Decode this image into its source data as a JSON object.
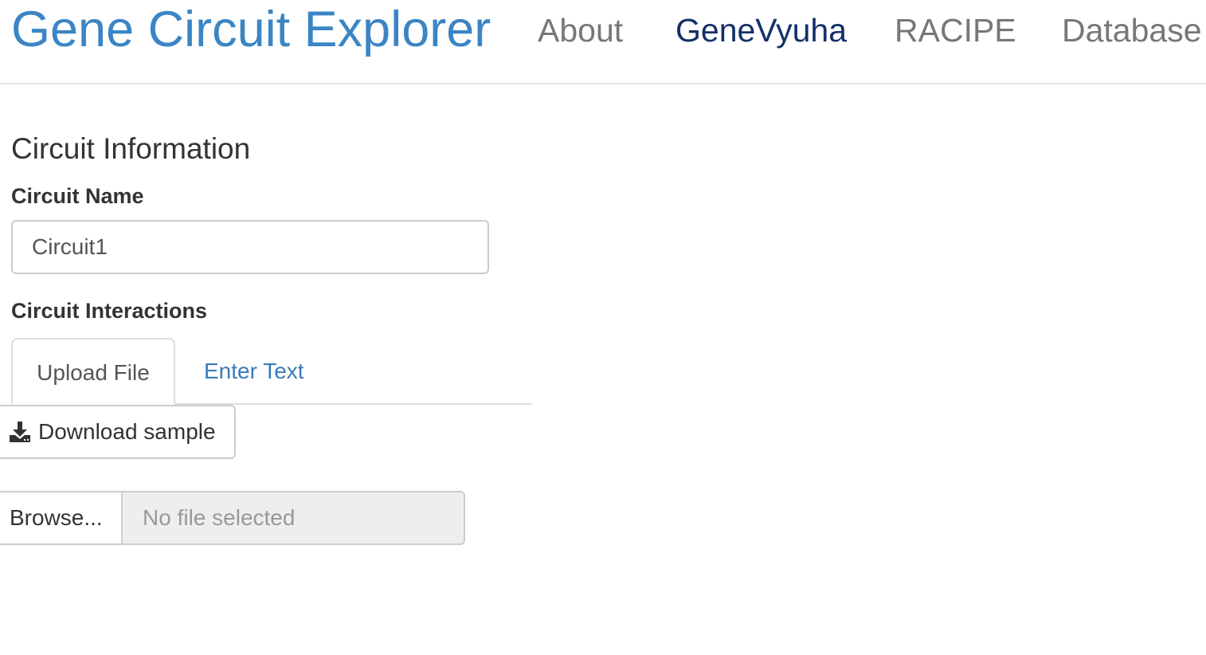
{
  "navbar": {
    "brand": "Gene Circuit Explorer",
    "items": [
      {
        "label": "About",
        "active": false
      },
      {
        "label": "GeneVyuha",
        "active": true
      },
      {
        "label": "RACIPE",
        "active": false
      },
      {
        "label": "Database",
        "active": false
      }
    ]
  },
  "circuit_info": {
    "title": "Circuit Information",
    "name_label": "Circuit Name",
    "name_value": "Circuit1",
    "interactions_label": "Circuit Interactions"
  },
  "tabs": [
    {
      "label": "Upload File",
      "active": true
    },
    {
      "label": "Enter Text",
      "active": false
    }
  ],
  "upload": {
    "download_label": "Download sample",
    "download_icon": "download-icon",
    "browse_label": "Browse...",
    "file_status": "No file selected"
  },
  "colors": {
    "brand": "#3a85c5",
    "nav_active": "#14306a",
    "nav_inactive": "#777777",
    "tab_link": "#3a7ab8"
  }
}
